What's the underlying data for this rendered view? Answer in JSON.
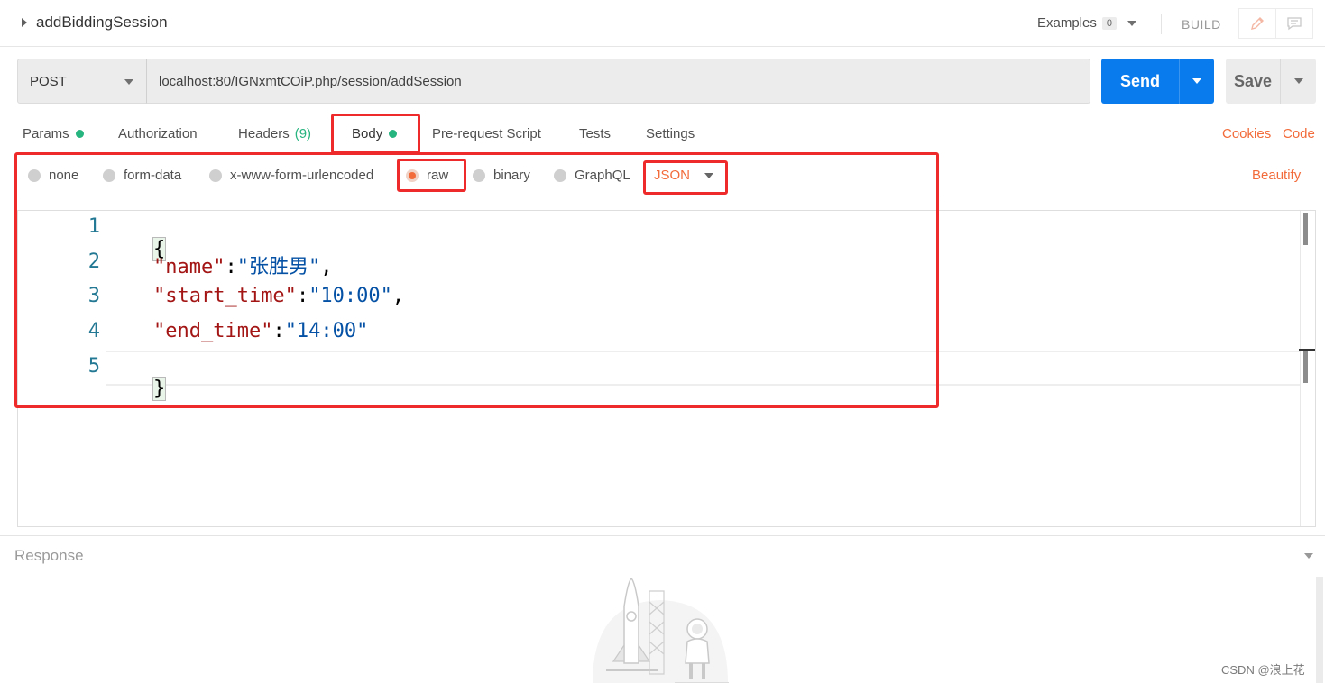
{
  "header": {
    "request_name": "addBiddingSession",
    "examples_label": "Examples",
    "examples_count": "0",
    "build_label": "BUILD",
    "icons": [
      "caret-right-icon",
      "chevron-down-icon",
      "pencil-icon",
      "comment-icon"
    ]
  },
  "request": {
    "method": "POST",
    "url": "localhost:80/IGNxmtCOiP.php/session/addSession",
    "send_label": "Send",
    "save_label": "Save"
  },
  "tabs": {
    "params": "Params",
    "authorization": "Authorization",
    "headers": "Headers",
    "headers_count": "(9)",
    "body": "Body",
    "prerequest": "Pre-request Script",
    "tests": "Tests",
    "settings": "Settings",
    "active": "Body"
  },
  "links": {
    "cookies": "Cookies",
    "code": "Code"
  },
  "body_options": {
    "modes": [
      "none",
      "form-data",
      "x-www-form-urlencoded",
      "raw",
      "binary",
      "GraphQL"
    ],
    "selected": "raw",
    "format": "JSON",
    "beautify_label": "Beautify"
  },
  "editor": {
    "line_numbers": [
      "1",
      "2",
      "3",
      "4",
      "5"
    ],
    "open_brace": "{",
    "close_brace": "}",
    "fields": [
      {
        "key": "\"name\"",
        "value": "\"张胜男\"",
        "trail": ","
      },
      {
        "key": "\"start_time\"",
        "value": "\"10:00\"",
        "trail": ","
      },
      {
        "key": "\"end_time\"",
        "value": "\"14:00\"",
        "trail": ""
      }
    ],
    "colors": {
      "key": "#a31515",
      "value": "#0451a5",
      "line_number": "#237893"
    }
  },
  "response": {
    "label": "Response"
  },
  "watermark": "CSDN @浪上花",
  "colors": {
    "accent": "#f26b3a",
    "send_button": "#097bed",
    "status_dot": "#26b47f",
    "annotation": "#ee2a2a"
  }
}
